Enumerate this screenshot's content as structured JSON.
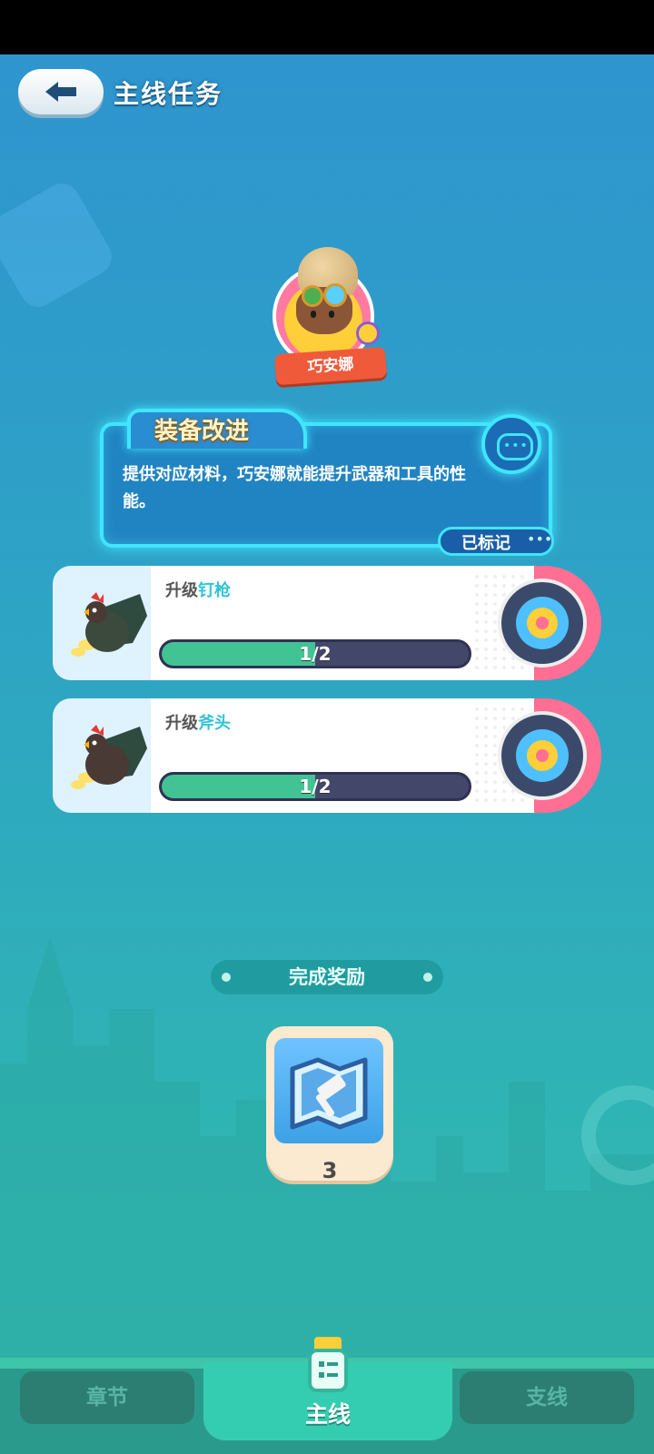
{
  "header": {
    "title": "主线任务",
    "back_icon": "back-arrow-icon"
  },
  "npc": {
    "name": "巧安娜"
  },
  "dialog": {
    "title": "装备改进",
    "text": "提供对应材料，巧安娜就能提升武器和工具的性能。",
    "marked_label": "已标记",
    "marked_dots": "•••"
  },
  "tasks": [
    {
      "prefix": "升级",
      "item": "钉枪",
      "progress_text": "1/2",
      "progress": 0.5
    },
    {
      "prefix": "升级",
      "item": "斧头",
      "progress_text": "1/2",
      "progress": 0.5
    }
  ],
  "reward": {
    "header": "完成奖励",
    "count": "3",
    "icon": "blueprint-hammer-icon"
  },
  "tabs": {
    "chapter": "章节",
    "main": "主线",
    "side": "支线"
  },
  "colors": {
    "accent_cyan": "#3fe6ff",
    "progress_fill": "#41c394",
    "card_cap": "#ff6f93"
  }
}
